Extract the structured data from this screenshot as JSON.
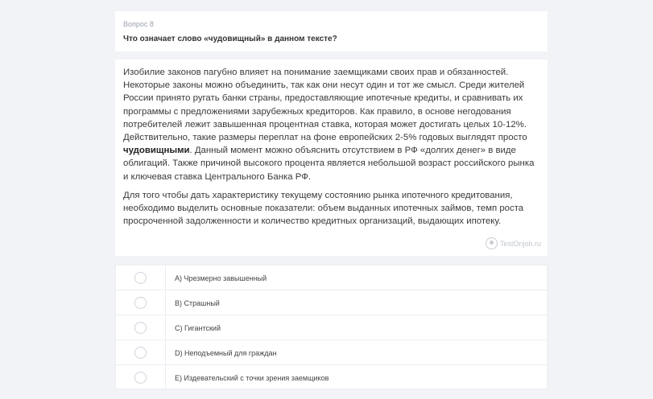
{
  "question": {
    "label": "Вопрос 8",
    "title": "Что означает слово «чудовищный» в данном тексте?"
  },
  "passage": {
    "p1_a": "Изобилие законов пагубно влияет на понимание заемщиками своих прав и обязанностей. Некоторые законы можно объединить, так как они несут один и тот же смысл. Среди жителей России принято ругать банки страны, предоставляющие ипотечные кредиты, и сравнивать их программы с предложениями зарубежных кредиторов. Как правило, в основе негодования потребителей лежит завышенная процентная ставка, которая может достигать целых 10-12%. Действительно, такие размеры переплат на фоне европейских 2-5% годовых выглядят просто ",
    "p1_bold": "чудовищными",
    "p1_b": ". Данный момент можно объяснить отсутствием в РФ «долгих денег» в виде облигаций. Также причиной высокого процента является небольшой возраст российского рынка и ключевая ставка Центрального Банка РФ.",
    "p2": "Для того чтобы дать характеристику текущему состоянию рынка ипотечного кредитования, необходимо выделить основные показатели: объем выданных ипотечных займов, темп роста просроченной задолженности и количество кредитных организаций, выдающих ипотеку."
  },
  "watermark": "TestOnjob.ru",
  "answers": [
    {
      "label": "A) Чрезмерно завышенный"
    },
    {
      "label": "B) Страшный"
    },
    {
      "label": "C) Гигантский"
    },
    {
      "label": "D) Неподъемный для граждан"
    },
    {
      "label": "E) Издевательский с точки зрения заемщиков"
    }
  ]
}
